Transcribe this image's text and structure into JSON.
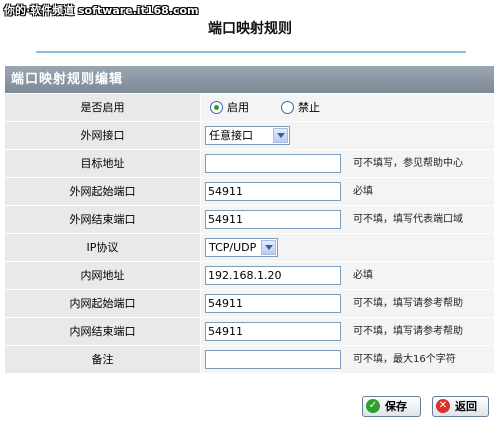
{
  "watermark": "你的·软件频道 software.it168.com",
  "page_title": "端口映射规则",
  "panel_title": "端口映射规则编辑",
  "rows": [
    {
      "label": "是否启用",
      "radio": {
        "option1": "启用",
        "option2": "禁止",
        "selected": "启用"
      }
    },
    {
      "label": "外网接口",
      "select": "任意接口"
    },
    {
      "label": "目标地址",
      "value": "",
      "hint": "可不填写，参见帮助中心"
    },
    {
      "label": "外网起始端口",
      "value": "54911",
      "hint": "必填"
    },
    {
      "label": "外网结束端口",
      "value": "54911",
      "hint": "可不填，填写代表端口域"
    },
    {
      "label": "IP协议",
      "select": "TCP/UDP"
    },
    {
      "label": "内网地址",
      "value": "192.168.1.20",
      "hint": "必填"
    },
    {
      "label": "内网起始端口",
      "value": "54911",
      "hint": "可不填，填写请参考帮助"
    },
    {
      "label": "内网结束端口",
      "value": "54911",
      "hint": "可不填，填写请参考帮助"
    },
    {
      "label": "备注",
      "value": "",
      "hint": "可不填，最大16个字符"
    }
  ],
  "buttons": {
    "save": "保存",
    "back": "返回"
  },
  "colors": {
    "accent_rule": "#8cbfe6",
    "header_bg": "#8894a1",
    "save_icon": "#2ea02e",
    "back_icon": "#d9322b"
  }
}
